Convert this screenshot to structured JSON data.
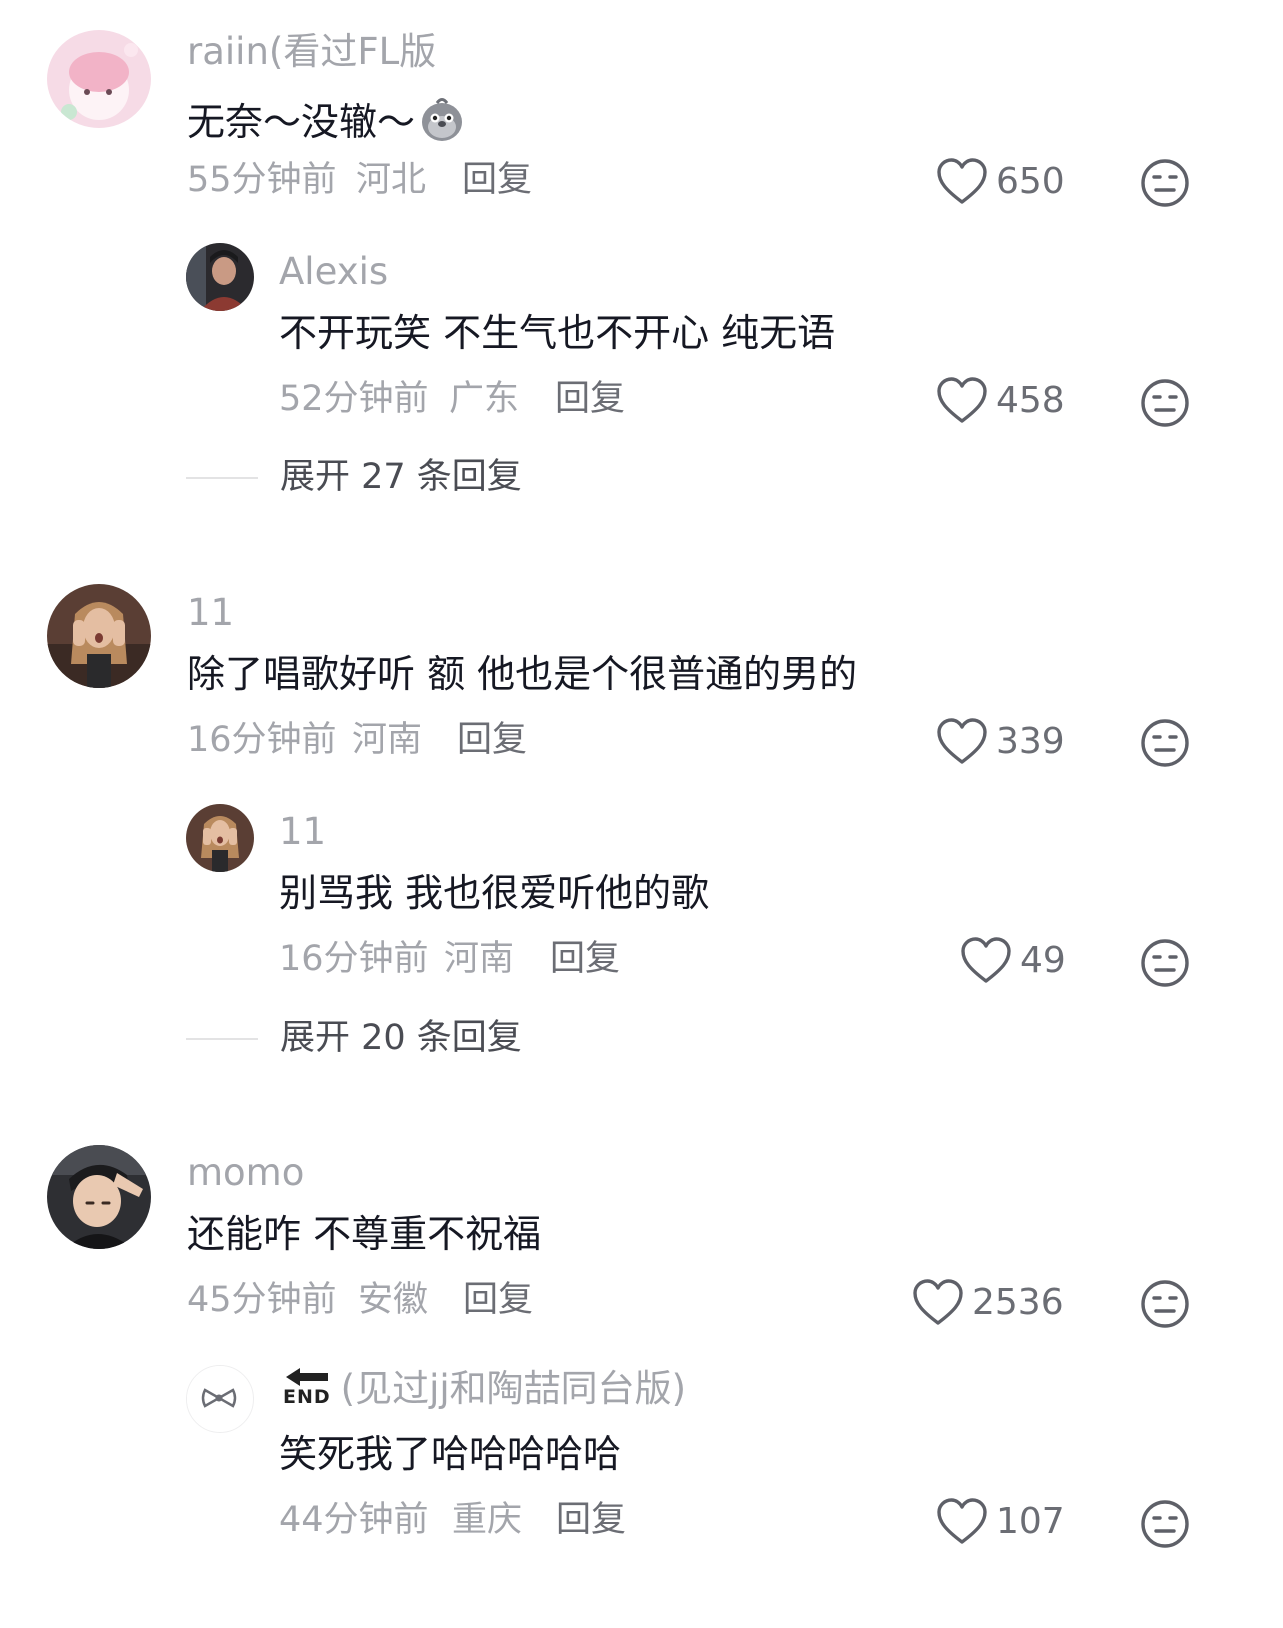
{
  "comments": [
    {
      "name": "raiin(看过FL版",
      "text": "无奈～没辙～",
      "time": "55分钟前",
      "region": "河北",
      "reply": "回复",
      "likes": "650"
    },
    {
      "name": "Alexis",
      "text": "不开玩笑 不生气也不开心 纯无语",
      "time": "52分钟前",
      "region": "广东",
      "reply": "回复",
      "likes": "458",
      "expand": "展开 27 条回复"
    },
    {
      "name": "11",
      "text": "除了唱歌好听 额 他也是个很普通的男的",
      "time": "16分钟前",
      "region": "河南",
      "reply": "回复",
      "likes": "339"
    },
    {
      "name": "11",
      "text": "别骂我 我也很爱听他的歌",
      "time": "16分钟前",
      "region": "河南",
      "reply": "回复",
      "likes": "49",
      "expand": "展开 20 条回复"
    },
    {
      "name": "momo",
      "text": "还能咋 不尊重不祝福",
      "time": "45分钟前",
      "region": "安徽",
      "reply": "回复",
      "likes": "2536"
    },
    {
      "name": "(见过jj和陶喆同台版)",
      "name_badge": "END",
      "text": "笑死我了哈哈哈哈哈",
      "time": "44分钟前",
      "region": "重庆",
      "reply": "回复",
      "likes": "107"
    }
  ],
  "icons": {
    "like": "heart-outline-icon",
    "dislike": "neutral-face-icon",
    "emoji": "pigeon-emoji-icon"
  },
  "colors": {
    "secondary_text": "#a3a5ab",
    "primary_text": "#161823",
    "action_text": "#6b6d74"
  }
}
